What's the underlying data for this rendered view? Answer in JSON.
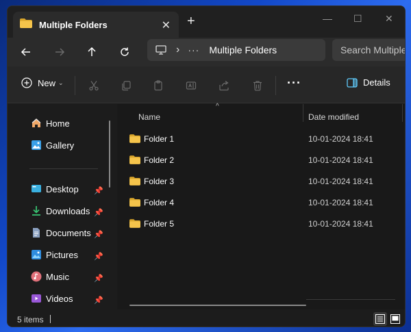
{
  "window": {
    "tab_title": "Multiple Folders",
    "tab_close": "✕",
    "new_tab": "+",
    "minimize": "—",
    "maximize": "☐",
    "close": "✕"
  },
  "nav": {
    "address_ellipsis": "···",
    "address_sep": "›",
    "address_location": "Multiple Folders",
    "search_placeholder": "Search Multiple Folders"
  },
  "toolbar": {
    "new_label": "New",
    "new_chevron": "⌄",
    "more": "···",
    "details_label": "Details"
  },
  "sidebar": {
    "items": [
      {
        "label": "Home",
        "icon": "home-icon"
      },
      {
        "label": "Gallery",
        "icon": "gallery-icon"
      },
      {
        "label": "Desktop",
        "icon": "desktop-icon",
        "pinned": true
      },
      {
        "label": "Downloads",
        "icon": "downloads-icon",
        "pinned": true
      },
      {
        "label": "Documents",
        "icon": "documents-icon",
        "pinned": true
      },
      {
        "label": "Pictures",
        "icon": "pictures-icon",
        "pinned": true
      },
      {
        "label": "Music",
        "icon": "music-icon",
        "pinned": true
      },
      {
        "label": "Videos",
        "icon": "videos-icon",
        "pinned": true
      }
    ],
    "pin_glyph": "📌"
  },
  "file_list": {
    "columns": [
      "Name",
      "Date modified"
    ],
    "sort_caret": "^",
    "rows": [
      {
        "name": "Folder 1",
        "date": "10-01-2024 18:41"
      },
      {
        "name": "Folder 2",
        "date": "10-01-2024 18:41"
      },
      {
        "name": "Folder 3",
        "date": "10-01-2024 18:41"
      },
      {
        "name": "Folder 4",
        "date": "10-01-2024 18:41"
      },
      {
        "name": "Folder 5",
        "date": "10-01-2024 18:41"
      }
    ]
  },
  "status": {
    "item_count": "5 items"
  },
  "colors": {
    "folder_yellow": "#f5c44b",
    "folder_yellow_dark": "#d9a62c",
    "accent_blue": "#60cdff"
  }
}
